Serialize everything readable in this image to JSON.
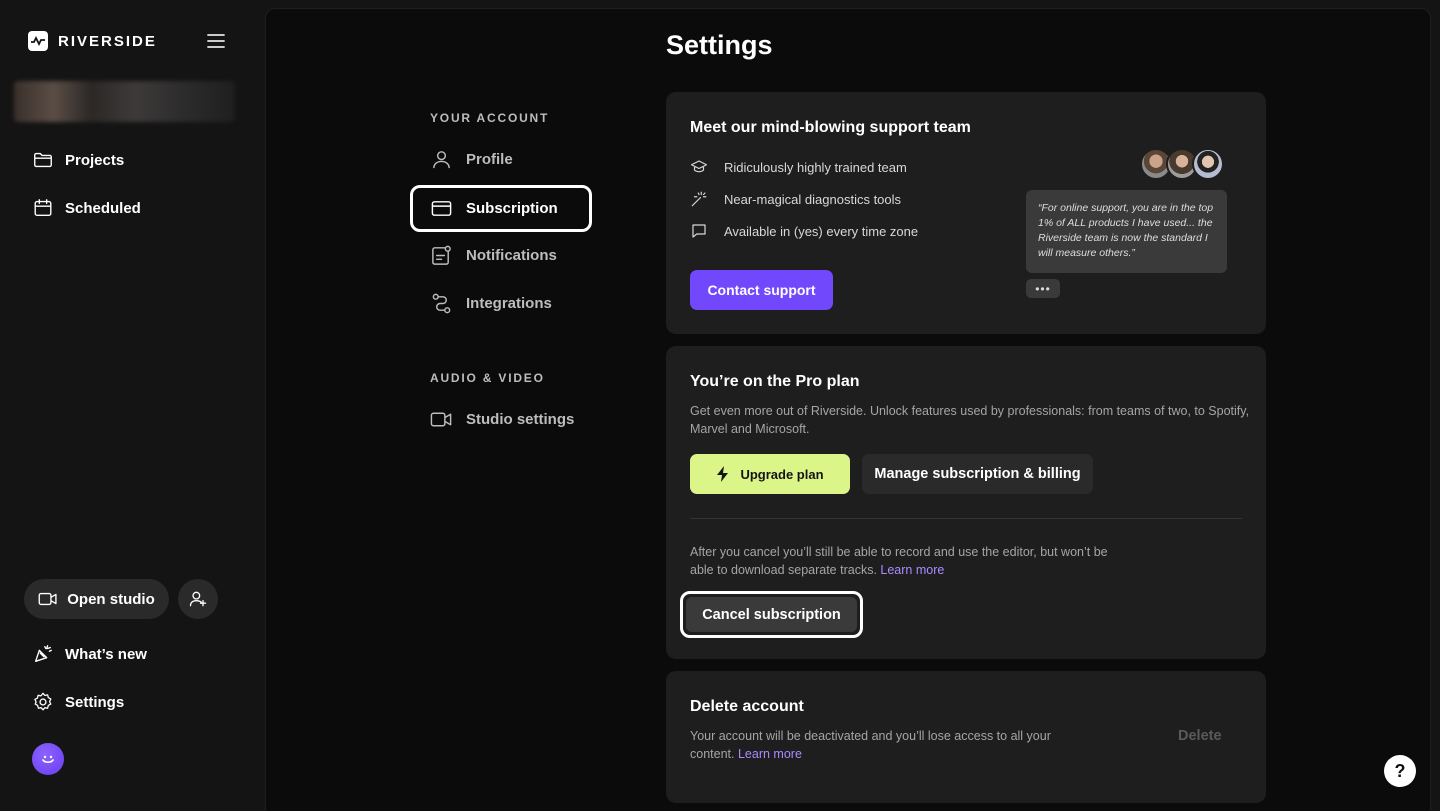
{
  "brand": {
    "name": "RIVERSIDE"
  },
  "sidebar": {
    "items": [
      {
        "label": "Projects",
        "icon": "folder-icon"
      },
      {
        "label": "Scheduled",
        "icon": "calendar-icon"
      }
    ],
    "open_studio_label": "Open studio",
    "bottom_items": [
      {
        "label": "What’s new",
        "icon": "party-icon"
      },
      {
        "label": "Settings",
        "icon": "gear-icon"
      }
    ]
  },
  "page": {
    "title": "Settings"
  },
  "settings_nav": {
    "your_account_label": "YOUR ACCOUNT",
    "account_items": [
      {
        "label": "Profile",
        "icon": "user-icon"
      },
      {
        "label": "Subscription",
        "icon": "credit-card-icon",
        "active": true
      },
      {
        "label": "Notifications",
        "icon": "notification-icon"
      },
      {
        "label": "Integrations",
        "icon": "integrations-icon"
      }
    ],
    "audio_video_label": "AUDIO & VIDEO",
    "av_items": [
      {
        "label": "Studio settings",
        "icon": "video-camera-icon"
      }
    ]
  },
  "support_card": {
    "title": "Meet our mind-blowing support team",
    "features": [
      {
        "text": "Ridiculously highly trained team",
        "icon": "graduation-cap-icon"
      },
      {
        "text": "Near-magical diagnostics tools",
        "icon": "magic-wand-icon"
      },
      {
        "text": "Available in (yes) every time zone",
        "icon": "chat-bubble-icon"
      }
    ],
    "button_label": "Contact support",
    "quote": "“For online support, you are in the top 1% of ALL products I have used... the Riverside team is now the standard I will measure others.”",
    "more_label": "•••"
  },
  "plan_card": {
    "title": "You’re on the Pro plan",
    "description": "Get even more out of Riverside. Unlock features used by professionals: from teams of two, to Spotify, Marvel and Microsoft.",
    "upgrade_label": "Upgrade plan",
    "manage_label": "Manage subscription & billing",
    "cancel_note": "After you cancel you’ll still be able to record and use the editor, but won’t be able to download separate tracks.",
    "cancel_link": "Learn more",
    "cancel_label": "Cancel subscription"
  },
  "delete_card": {
    "title": "Delete account",
    "description": "Your account will be deactivated and you’ll lose access to all your content.",
    "link": "Learn more",
    "delete_label": "Delete"
  },
  "help": {
    "label": "?"
  },
  "colors": {
    "accent_purple": "#7148fc",
    "accent_lime": "#dcf589",
    "link": "#a98bff"
  }
}
